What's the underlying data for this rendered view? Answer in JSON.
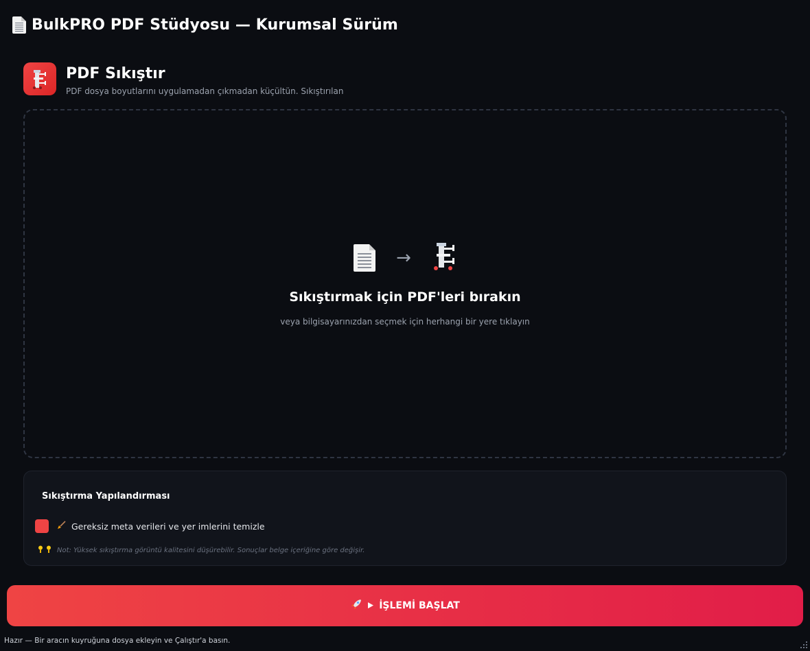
{
  "window": {
    "title": "BulkPRO PDF Stüdyosu — Kurumsal Sürüm",
    "title_icon": "document-icon"
  },
  "tool": {
    "title": "PDF Sıkıştır",
    "description": "PDF dosya boyutlarını uygulamadan çıkmadan küçültün. Sıkıştırılan",
    "icon": "clamp-icon",
    "accent": "#ef4444"
  },
  "dropzone": {
    "title": "Sıkıştırmak için PDF'leri bırakın",
    "subtitle": "veya bilgisayarınızdan seçmek için herhangi bir yere tıklayın",
    "arrow": "→"
  },
  "config": {
    "title": "Sıkıştırma Yapılandırması",
    "option_label": "Gereksiz meta verileri ve yer imlerini temizle",
    "option_checked": true,
    "note": "Not: Yüksek sıkıştırma görüntü kalitesini düşürebilir. Sonuçlar belge içeriğine göre değişir."
  },
  "action": {
    "start_label": "İŞLEMİ BAŞLAT",
    "gradient": [
      "#ef4444",
      "#e11d48"
    ]
  },
  "status": {
    "text": "Hazır — Bir aracın kuyruğuna dosya ekleyin ve Çalıştır'a basın."
  }
}
